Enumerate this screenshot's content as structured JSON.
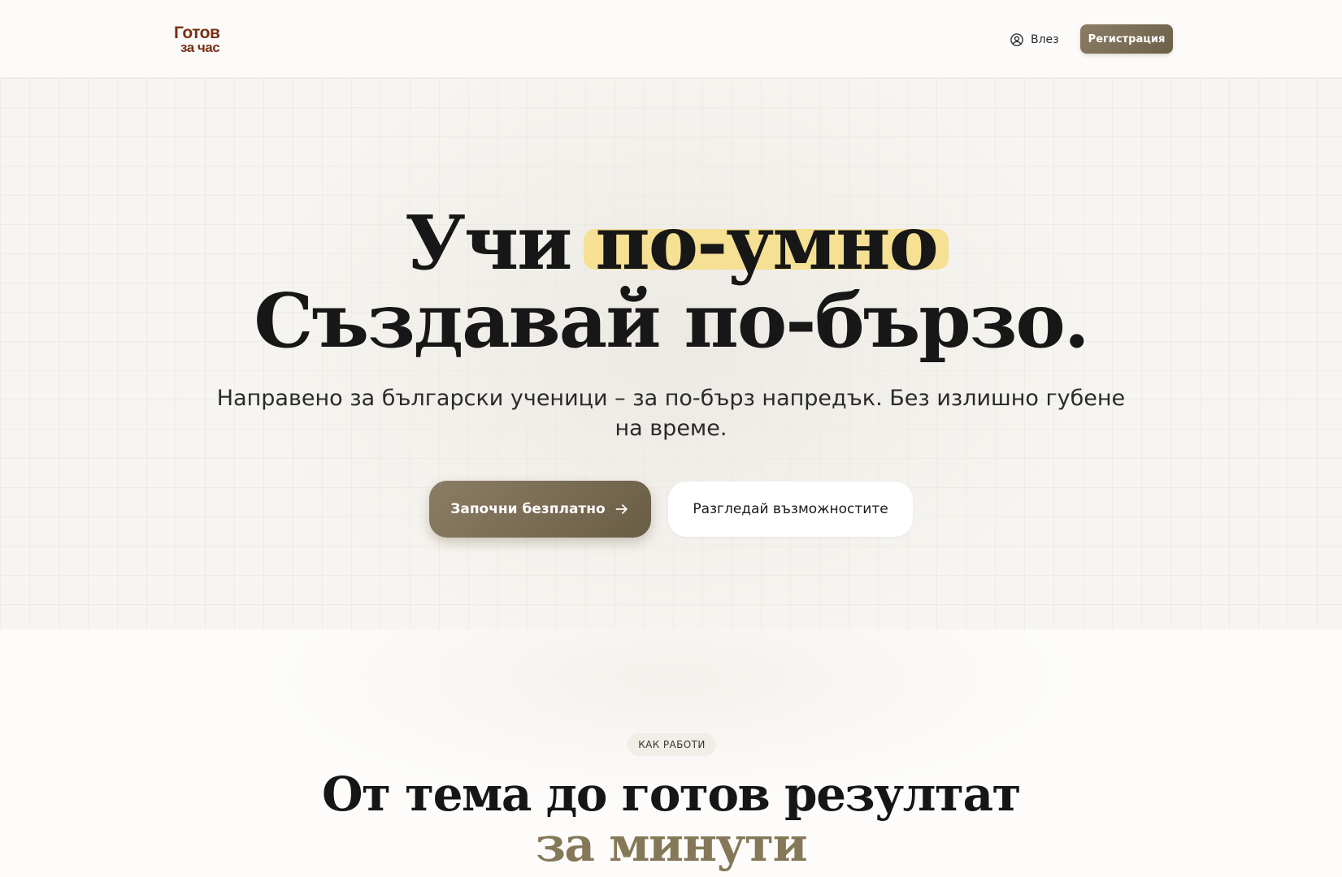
{
  "header": {
    "logo_line1": "Готов",
    "logo_line2": "за час",
    "login_label": "Влез",
    "register_label": "Регистрация"
  },
  "hero": {
    "title_word1": "Учи",
    "title_highlight": "по-умно",
    "title_line2": "Създавай по-бързо.",
    "subtitle": "Направено за български ученици – за по-бърз напредък. Без излишно губене на време.",
    "cta_primary": "Започни безплатно",
    "cta_secondary": "Разгледай възможностите"
  },
  "how_it_works": {
    "badge": "КАК РАБОТИ",
    "title_line1": "От тема до готов резултат",
    "title_line2": "за минути"
  },
  "colors": {
    "brand": "#7a2e14",
    "accent": "#7a6d55",
    "highlight": "#f5de8a"
  },
  "icons": {
    "login": "user-circle-icon",
    "cta_arrow": "arrow-right-icon",
    "logo_clock": "stopwatch-icon"
  }
}
